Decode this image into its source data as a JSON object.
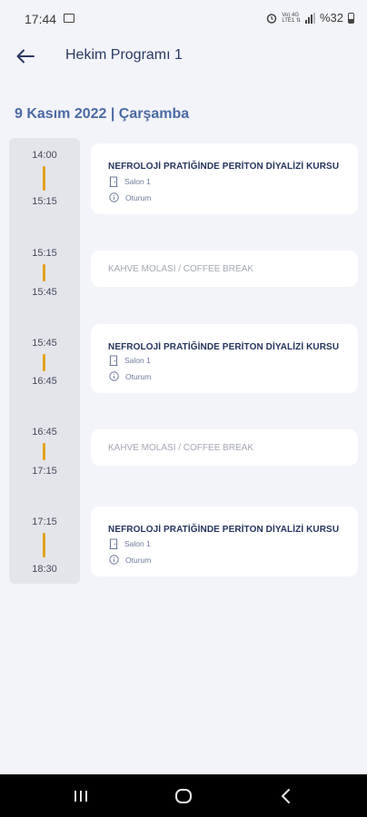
{
  "status_bar": {
    "time": "17:44",
    "network_label_1": "Vo) 4G",
    "network_label_2": "LTE1 ⇅",
    "battery_text": "%32"
  },
  "header": {
    "title": "Hekim Programı 1"
  },
  "date_heading": "9 Kasım 2022 | Çarşamba",
  "schedule": [
    {
      "start": "14:00",
      "end": "15:15",
      "type": "session",
      "title": "NEFROLOJİ PRATİĞİNDE PERİTON DİYALİZİ KURSU",
      "room": "Salon 1",
      "kind": "Oturum"
    },
    {
      "start": "15:15",
      "end": "15:45",
      "type": "break",
      "title": "KAHVE MOLASI / COFFEE BREAK"
    },
    {
      "start": "15:45",
      "end": "16:45",
      "type": "session",
      "title": "NEFROLOJİ PRATİĞİNDE PERİTON DİYALİZİ KURSU",
      "room": "Salon 1",
      "kind": "Oturum"
    },
    {
      "start": "16:45",
      "end": "17:15",
      "type": "break",
      "title": "KAHVE MOLASI / COFFEE BREAK"
    },
    {
      "start": "17:15",
      "end": "18:30",
      "type": "session",
      "title": "NEFROLOJİ PRATİĞİNDE PERİTON DİYALİZİ KURSU",
      "room": "Salon 1",
      "kind": "Oturum"
    }
  ],
  "colors": {
    "accent_bar": "#e3a21f",
    "heading": "#4a6aa6",
    "title": "#24345e",
    "background": "#f3f4f9"
  },
  "icons": {
    "back": "arrow-left-icon",
    "room": "door-icon",
    "kind": "info-circle-icon",
    "nav_recent": "recent-apps-icon",
    "nav_home": "home-icon",
    "nav_back": "chevron-left-icon"
  }
}
